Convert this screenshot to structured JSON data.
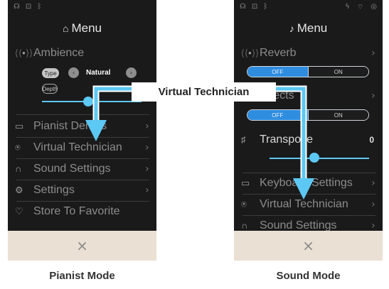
{
  "callout": {
    "label": "Virtual Technician",
    "color": "#5cc8f3"
  },
  "left_screen": {
    "caption": "Pianist Mode",
    "status_icons": [
      "headphones-icon",
      "lock-icon",
      "bluetooth-icon"
    ],
    "menu_title": "Menu",
    "ambience": {
      "label": "Ambience",
      "type_label": "Type",
      "type_value": "Natural",
      "depth_label": "Depth",
      "depth_level_percent": 45
    },
    "items": [
      {
        "label": "Pianist Demos",
        "icon": "piano-icon",
        "chevron": "›"
      },
      {
        "label": "Virtual Technician",
        "icon": "technician-icon",
        "chevron": "›"
      },
      {
        "label": "Sound Settings",
        "icon": "headphones-icon",
        "chevron": "›"
      },
      {
        "label": "Settings",
        "icon": "gear-icon",
        "chevron": "›"
      },
      {
        "label": "Store To Favorite",
        "icon": "heart-icon",
        "chevron": ""
      }
    ],
    "close_symbol": "×"
  },
  "right_screen": {
    "caption": "Sound Mode",
    "status_icons": [
      "headphones-icon",
      "lock-icon",
      "bluetooth-icon",
      "power-icon",
      "wifi-icon",
      "signal-icon"
    ],
    "menu_title": "Menu",
    "reverb": {
      "label": "Reverb",
      "off": "OFF",
      "on": "ON"
    },
    "effects": {
      "label": "Effects",
      "off": "OFF",
      "on": "ON"
    },
    "transpose": {
      "label": "Transpose",
      "value": "0",
      "level_percent": 40
    },
    "items": [
      {
        "label": "Keyboard Settings",
        "icon": "keyboard-icon",
        "chevron": "›"
      },
      {
        "label": "Virtual Technician",
        "icon": "technician-icon",
        "chevron": "›"
      },
      {
        "label": "Sound Settings",
        "icon": "headphones-icon",
        "chevron": "›"
      }
    ],
    "close_symbol": "×"
  }
}
